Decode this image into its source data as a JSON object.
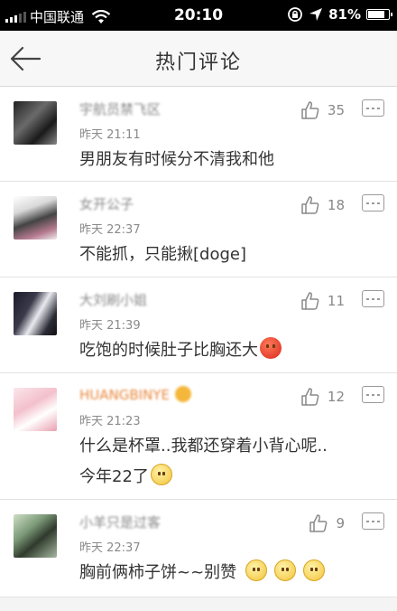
{
  "status_bar": {
    "carrier": "中国联通",
    "time": "20:10",
    "battery": "81%",
    "battery_level": 0.81
  },
  "nav": {
    "back_icon": "back-arrow-icon",
    "title": "热门评论"
  },
  "comments": [
    {
      "username": "宇航员禁飞区",
      "time": "昨天 21:11",
      "text": "男朋友有时候分不清我和他",
      "likes": "35"
    },
    {
      "username": "女开公子",
      "time": "昨天 22:37",
      "text": "不能抓，只能揪[doge]",
      "likes": "18"
    },
    {
      "username": "大刘刷小姐",
      "time": "昨天 21:39",
      "text": "吃饱的时候肚子比胸还大",
      "likes": "11",
      "emoji": "angry-face-icon"
    },
    {
      "username": "HUANGBINYE",
      "time": "昨天 21:23",
      "text": "什么是杯罩..我都还穿着小背心呢..",
      "text2": "今年22了",
      "likes": "12",
      "emoji": "shy-smile-icon"
    },
    {
      "username": "小羊只是过客",
      "time": "昨天 22:37",
      "text": "胸前俩柿子饼~~别赞",
      "likes": "9",
      "emoji": "shy-smile-icon"
    }
  ],
  "colors": {
    "background": "#f4f4f4",
    "status_bar": "#000000",
    "text": "#333333",
    "meta": "#888888",
    "vip_name": "#e8863a"
  }
}
